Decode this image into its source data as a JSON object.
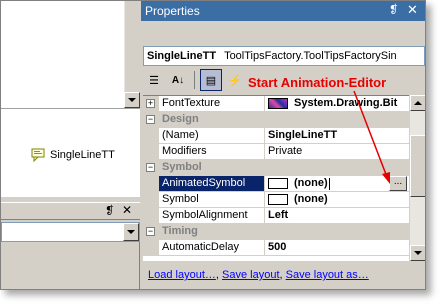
{
  "designer": {
    "component_label": "SingleLineTT"
  },
  "left_panel": {
    "pin_glyph": "❡",
    "close_glyph": "✕"
  },
  "properties": {
    "title": "Properties",
    "pin_glyph": "❡",
    "close_glyph": "✕",
    "object_name": "SingleLineTT",
    "object_type": "ToolTipsFactory.ToolTipsFactorySin",
    "toolbar": {
      "categorized_label": "☰",
      "alphabetical_label": "A↓",
      "properties_label": "▤",
      "events_label": "⚡"
    },
    "annotation": "Start Animation-Editor",
    "rows": [
      {
        "type": "prop",
        "name": "FontTexture",
        "value": "System.Drawing.Bit",
        "expander": "+",
        "bold": true,
        "swatch": "image"
      },
      {
        "type": "cat",
        "name": "Design",
        "expander": "−"
      },
      {
        "type": "prop",
        "name": "(Name)",
        "value": "SingleLineTT",
        "bold": true
      },
      {
        "type": "prop",
        "name": "Modifiers",
        "value": "Private"
      },
      {
        "type": "cat",
        "name": "Symbol",
        "expander": "−"
      },
      {
        "type": "prop",
        "name": "AnimatedSymbol",
        "value": "(none)",
        "bold": true,
        "swatch": "white",
        "selected": true,
        "ellipsis": "..."
      },
      {
        "type": "prop",
        "name": "Symbol",
        "value": "(none)",
        "bold": true,
        "swatch": "white"
      },
      {
        "type": "prop",
        "name": "SymbolAlignment",
        "value": "Left",
        "bold": true
      },
      {
        "type": "cat",
        "name": "Timing",
        "expander": "−"
      },
      {
        "type": "prop",
        "name": "AutomaticDelay",
        "value": "500",
        "bold": true
      }
    ],
    "commands": {
      "load": "Load layout…",
      "save": "Save layout",
      "save_as": "Save layout as…",
      "separator": ","
    }
  },
  "colors": {
    "title_bar": "#3b6ea5",
    "annotation": "#e60000",
    "selection": "#0a246a",
    "link": "#0000ff"
  },
  "icons": [
    "categorized-icon",
    "alphabetical-icon",
    "properties-icon",
    "events-icon",
    "tooltip-component-icon",
    "pin-icon",
    "close-icon",
    "expand-icon",
    "collapse-icon",
    "scroll-up-icon",
    "scroll-down-icon",
    "dropdown-arrow-icon"
  ]
}
